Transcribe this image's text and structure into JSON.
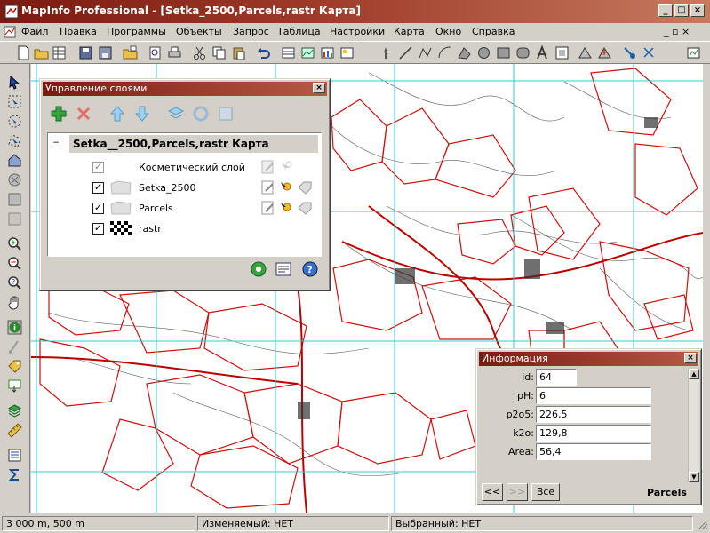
{
  "window": {
    "title": "MapInfo Professional - [Setka_2500,Parcels,rastr Карта]",
    "buttons": [
      "_",
      "□",
      "×"
    ]
  },
  "menubar": {
    "items": [
      "Файл",
      "Правка",
      "Программы",
      "Объекты",
      "Запрос",
      "Таблица",
      "Настройки",
      "Карта",
      "Окно",
      "Справка"
    ],
    "mdi_controls": "_ ▫ ×"
  },
  "layer_control": {
    "title": "Управление слоями",
    "map_name": "Setka__2500,Parcels,rastr Карта",
    "layers": [
      {
        "name": "Косметический слой",
        "visible": true,
        "enabled": false
      },
      {
        "name": "Setka_2500",
        "visible": true,
        "enabled": true
      },
      {
        "name": "Parcels",
        "visible": true,
        "enabled": true
      },
      {
        "name": "rastr",
        "visible": true,
        "enabled": true
      }
    ]
  },
  "info_window": {
    "title": "Информация",
    "fields": [
      {
        "label": "id:",
        "value": "64"
      },
      {
        "label": "pH:",
        "value": "6"
      },
      {
        "label": "p2o5:",
        "value": "226,5"
      },
      {
        "label": "k2o:",
        "value": "129,8"
      },
      {
        "label": "Area:",
        "value": "56,4"
      }
    ],
    "nav_prev": "<<",
    "nav_next": ">>",
    "nav_all": "Все",
    "table_name": "Parcels"
  },
  "status": {
    "scale": "3 000 m, 500 m",
    "editable": "Изменяемый: НЕТ",
    "selectable": "Выбранный: НЕТ"
  },
  "colors": {
    "title_start": "#7a1a10",
    "title_end": "#c67a5e",
    "grid": "#33cccc",
    "parcel": "#cc1111"
  }
}
